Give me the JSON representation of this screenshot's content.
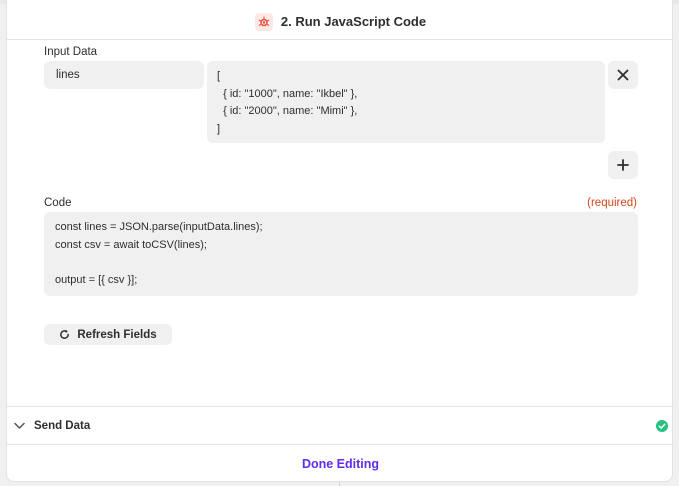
{
  "header": {
    "title": "2. Run JavaScript Code"
  },
  "input_data": {
    "label": "Input Data",
    "key": "lines",
    "value_lines": [
      "[",
      "  { id: \"1000\", name: \"Ikbel\" },",
      "  { id: \"2000\", name: \"Mimi\" },",
      "]"
    ]
  },
  "code": {
    "label": "Code",
    "required_label": "(required)",
    "lines": [
      "const lines = JSON.parse(inputData.lines);",
      "const csv = await toCSV(lines);",
      "",
      "output = [{ csv }];"
    ]
  },
  "refresh_button": {
    "label": "Refresh Fields"
  },
  "send_data": {
    "label": "Send Data",
    "status": "complete"
  },
  "done_button": {
    "label": "Done Editing"
  },
  "colors": {
    "accent": "#5f2ced",
    "required": "#d5481f",
    "success": "#26c281",
    "app_icon": "#e8483a"
  }
}
